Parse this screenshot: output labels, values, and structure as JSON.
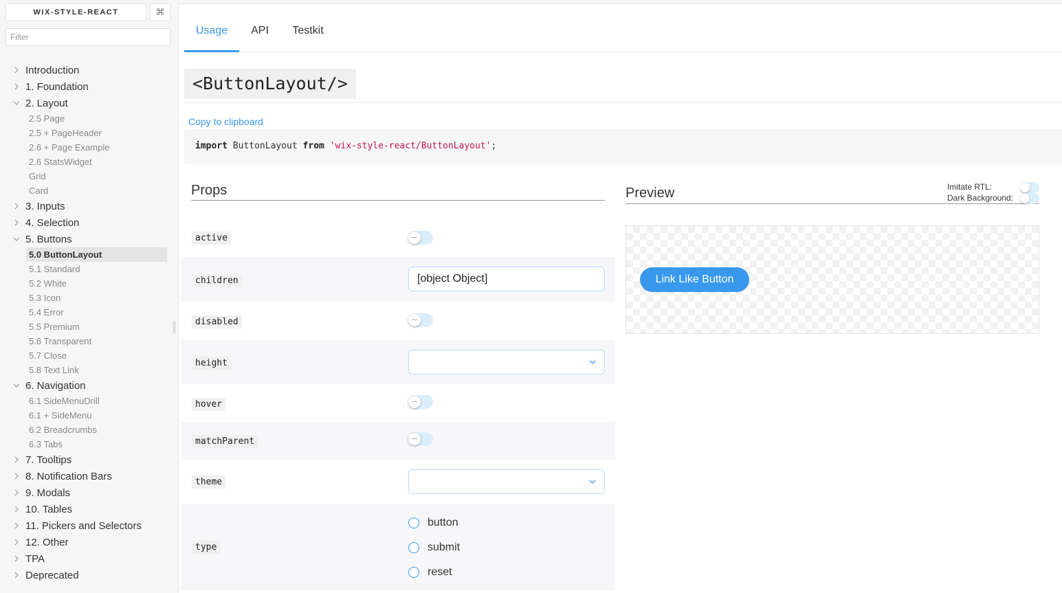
{
  "sidebar": {
    "brand": "WIX-STYLE-REACT",
    "shortcut_icon": "command-icon",
    "filter_placeholder": "Filter",
    "sections": [
      {
        "label": "Introduction",
        "expanded": false
      },
      {
        "label": "1. Foundation",
        "expanded": false
      },
      {
        "label": "2. Layout",
        "expanded": true,
        "children": [
          "2.5 Page",
          "2.5 + PageHeader",
          "2.6 + Page Example",
          "2.6 StatsWidget",
          "Grid",
          "Card"
        ]
      },
      {
        "label": "3. Inputs",
        "expanded": false
      },
      {
        "label": "4. Selection",
        "expanded": false
      },
      {
        "label": "5. Buttons",
        "expanded": true,
        "children": [
          "5.0 ButtonLayout",
          "5.1 Standard",
          "5.2 White",
          "5.3 Icon",
          "5.4 Error",
          "5.5 Premium",
          "5.6 Transparent",
          "5.7 Close",
          "5.8 Text Link"
        ],
        "active_child": "5.0 ButtonLayout"
      },
      {
        "label": "6. Navigation",
        "expanded": true,
        "children": [
          "6.1 SideMenuDrill",
          "6.1 + SideMenu",
          "6.2 Breadcrumbs",
          "6.3 Tabs"
        ]
      },
      {
        "label": "7. Tooltips",
        "expanded": false
      },
      {
        "label": "8. Notification Bars",
        "expanded": false
      },
      {
        "label": "9. Modals",
        "expanded": false
      },
      {
        "label": "10. Tables",
        "expanded": false
      },
      {
        "label": "11. Pickers and Selectors",
        "expanded": false
      },
      {
        "label": "12. Other",
        "expanded": false
      },
      {
        "label": "TPA",
        "expanded": false
      },
      {
        "label": "Deprecated",
        "expanded": false
      }
    ]
  },
  "tabs": [
    {
      "label": "Usage",
      "active": true
    },
    {
      "label": "API",
      "active": false
    },
    {
      "label": "Testkit",
      "active": false
    }
  ],
  "component_title": "<ButtonLayout/>",
  "copy_label": "Copy to clipboard",
  "import_code": {
    "kw_import": "import",
    "name": " ButtonLayout ",
    "kw_from": "from",
    "path": "'wix-style-react/ButtonLayout'",
    "semi": ";"
  },
  "props": {
    "title": "Props",
    "rows": [
      {
        "name": "active",
        "control": "toggle",
        "value": false
      },
      {
        "name": "children",
        "control": "input",
        "value": "[object Object]"
      },
      {
        "name": "disabled",
        "control": "toggle",
        "value": false
      },
      {
        "name": "height",
        "control": "select",
        "value": ""
      },
      {
        "name": "hover",
        "control": "toggle",
        "value": false
      },
      {
        "name": "matchParent",
        "control": "toggle",
        "value": false
      },
      {
        "name": "theme",
        "control": "select",
        "value": ""
      },
      {
        "name": "type",
        "control": "radio",
        "options": [
          "button",
          "submit",
          "reset"
        ]
      }
    ]
  },
  "preview": {
    "title": "Preview",
    "rtl_label": "Imitate RTL:",
    "dark_label": "Dark Background:",
    "rtl_value": false,
    "dark_value": false,
    "button_label": "Link Like Button"
  },
  "colors": {
    "accent": "#3899ec",
    "string": "#c41a4c",
    "toggle_track": "#dbeefb"
  }
}
